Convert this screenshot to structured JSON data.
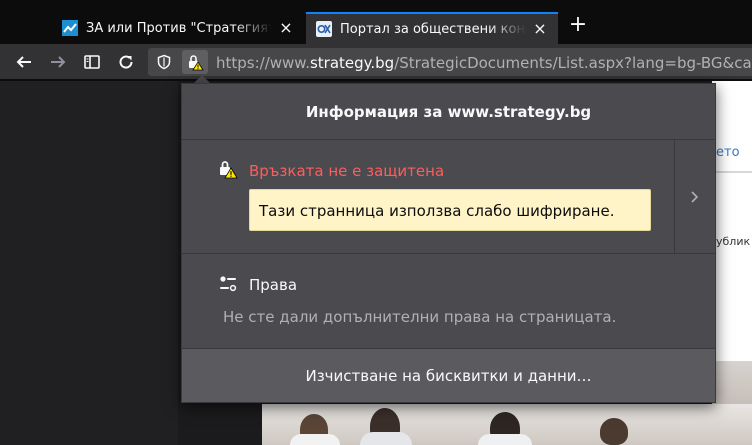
{
  "tabs": [
    {
      "title": "ЗА или Против \"Стратегият",
      "favicon": "trend-chart-favicon"
    },
    {
      "title": "Портал за обществени кон",
      "favicon": "strategy-logo-favicon"
    }
  ],
  "toolbar": {
    "url_prefix": "https://www.",
    "url_domain": "strategy.bg",
    "url_path": "/StrategicDocuments/List.aspx?lang=bg-BG&cat"
  },
  "background_page": {
    "right_link_fragment": "ето",
    "right_text_fragment": "ублик"
  },
  "popup": {
    "title": "Информация за www.strategy.bg",
    "connection": {
      "status": "Връзката не е защитена",
      "tooltip": "Тази странница използва слабо шифриране."
    },
    "permissions": {
      "title": "Права",
      "description": "Не сте дали допълнителни права на страницата."
    },
    "clear_button": "Изчистване на бисквитки и данни…"
  },
  "colors": {
    "accent": "#0a84ff",
    "warning_text": "#ff5d5d",
    "tooltip_bg": "#fff4c7",
    "panel_bg": "#4a4a4f"
  }
}
